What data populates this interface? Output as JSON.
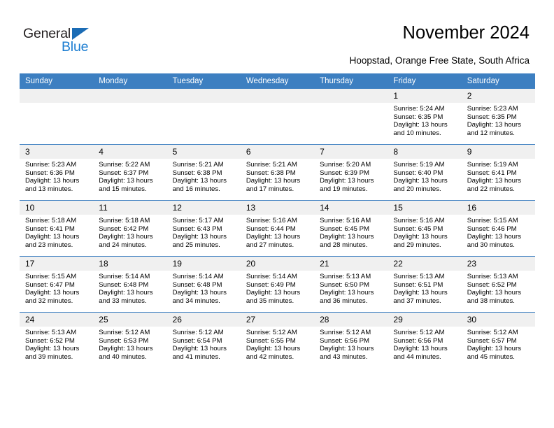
{
  "brand": {
    "name_top": "General",
    "name_bottom": "Blue",
    "color_dark": "#231f20",
    "color_blue": "#1b7dd1"
  },
  "header": {
    "title": "November 2024",
    "subtitle": "Hoopstad, Orange Free State, South Africa"
  },
  "theme": {
    "header_row_bg": "#3d7fc1",
    "daynum_bg": "#f0f0f0",
    "grid_line": "#3d7fc1"
  },
  "weekdays": [
    "Sunday",
    "Monday",
    "Tuesday",
    "Wednesday",
    "Thursday",
    "Friday",
    "Saturday"
  ],
  "weeks": [
    [
      {
        "day": "",
        "empty": true
      },
      {
        "day": "",
        "empty": true
      },
      {
        "day": "",
        "empty": true
      },
      {
        "day": "",
        "empty": true
      },
      {
        "day": "",
        "empty": true
      },
      {
        "day": "1",
        "sunrise": "Sunrise: 5:24 AM",
        "sunset": "Sunset: 6:35 PM",
        "daylight": "Daylight: 13 hours and 10 minutes."
      },
      {
        "day": "2",
        "sunrise": "Sunrise: 5:23 AM",
        "sunset": "Sunset: 6:35 PM",
        "daylight": "Daylight: 13 hours and 12 minutes."
      }
    ],
    [
      {
        "day": "3",
        "sunrise": "Sunrise: 5:23 AM",
        "sunset": "Sunset: 6:36 PM",
        "daylight": "Daylight: 13 hours and 13 minutes."
      },
      {
        "day": "4",
        "sunrise": "Sunrise: 5:22 AM",
        "sunset": "Sunset: 6:37 PM",
        "daylight": "Daylight: 13 hours and 15 minutes."
      },
      {
        "day": "5",
        "sunrise": "Sunrise: 5:21 AM",
        "sunset": "Sunset: 6:38 PM",
        "daylight": "Daylight: 13 hours and 16 minutes."
      },
      {
        "day": "6",
        "sunrise": "Sunrise: 5:21 AM",
        "sunset": "Sunset: 6:38 PM",
        "daylight": "Daylight: 13 hours and 17 minutes."
      },
      {
        "day": "7",
        "sunrise": "Sunrise: 5:20 AM",
        "sunset": "Sunset: 6:39 PM",
        "daylight": "Daylight: 13 hours and 19 minutes."
      },
      {
        "day": "8",
        "sunrise": "Sunrise: 5:19 AM",
        "sunset": "Sunset: 6:40 PM",
        "daylight": "Daylight: 13 hours and 20 minutes."
      },
      {
        "day": "9",
        "sunrise": "Sunrise: 5:19 AM",
        "sunset": "Sunset: 6:41 PM",
        "daylight": "Daylight: 13 hours and 22 minutes."
      }
    ],
    [
      {
        "day": "10",
        "sunrise": "Sunrise: 5:18 AM",
        "sunset": "Sunset: 6:41 PM",
        "daylight": "Daylight: 13 hours and 23 minutes."
      },
      {
        "day": "11",
        "sunrise": "Sunrise: 5:18 AM",
        "sunset": "Sunset: 6:42 PM",
        "daylight": "Daylight: 13 hours and 24 minutes."
      },
      {
        "day": "12",
        "sunrise": "Sunrise: 5:17 AM",
        "sunset": "Sunset: 6:43 PM",
        "daylight": "Daylight: 13 hours and 25 minutes."
      },
      {
        "day": "13",
        "sunrise": "Sunrise: 5:16 AM",
        "sunset": "Sunset: 6:44 PM",
        "daylight": "Daylight: 13 hours and 27 minutes."
      },
      {
        "day": "14",
        "sunrise": "Sunrise: 5:16 AM",
        "sunset": "Sunset: 6:45 PM",
        "daylight": "Daylight: 13 hours and 28 minutes."
      },
      {
        "day": "15",
        "sunrise": "Sunrise: 5:16 AM",
        "sunset": "Sunset: 6:45 PM",
        "daylight": "Daylight: 13 hours and 29 minutes."
      },
      {
        "day": "16",
        "sunrise": "Sunrise: 5:15 AM",
        "sunset": "Sunset: 6:46 PM",
        "daylight": "Daylight: 13 hours and 30 minutes."
      }
    ],
    [
      {
        "day": "17",
        "sunrise": "Sunrise: 5:15 AM",
        "sunset": "Sunset: 6:47 PM",
        "daylight": "Daylight: 13 hours and 32 minutes."
      },
      {
        "day": "18",
        "sunrise": "Sunrise: 5:14 AM",
        "sunset": "Sunset: 6:48 PM",
        "daylight": "Daylight: 13 hours and 33 minutes."
      },
      {
        "day": "19",
        "sunrise": "Sunrise: 5:14 AM",
        "sunset": "Sunset: 6:48 PM",
        "daylight": "Daylight: 13 hours and 34 minutes."
      },
      {
        "day": "20",
        "sunrise": "Sunrise: 5:14 AM",
        "sunset": "Sunset: 6:49 PM",
        "daylight": "Daylight: 13 hours and 35 minutes."
      },
      {
        "day": "21",
        "sunrise": "Sunrise: 5:13 AM",
        "sunset": "Sunset: 6:50 PM",
        "daylight": "Daylight: 13 hours and 36 minutes."
      },
      {
        "day": "22",
        "sunrise": "Sunrise: 5:13 AM",
        "sunset": "Sunset: 6:51 PM",
        "daylight": "Daylight: 13 hours and 37 minutes."
      },
      {
        "day": "23",
        "sunrise": "Sunrise: 5:13 AM",
        "sunset": "Sunset: 6:52 PM",
        "daylight": "Daylight: 13 hours and 38 minutes."
      }
    ],
    [
      {
        "day": "24",
        "sunrise": "Sunrise: 5:13 AM",
        "sunset": "Sunset: 6:52 PM",
        "daylight": "Daylight: 13 hours and 39 minutes."
      },
      {
        "day": "25",
        "sunrise": "Sunrise: 5:12 AM",
        "sunset": "Sunset: 6:53 PM",
        "daylight": "Daylight: 13 hours and 40 minutes."
      },
      {
        "day": "26",
        "sunrise": "Sunrise: 5:12 AM",
        "sunset": "Sunset: 6:54 PM",
        "daylight": "Daylight: 13 hours and 41 minutes."
      },
      {
        "day": "27",
        "sunrise": "Sunrise: 5:12 AM",
        "sunset": "Sunset: 6:55 PM",
        "daylight": "Daylight: 13 hours and 42 minutes."
      },
      {
        "day": "28",
        "sunrise": "Sunrise: 5:12 AM",
        "sunset": "Sunset: 6:56 PM",
        "daylight": "Daylight: 13 hours and 43 minutes."
      },
      {
        "day": "29",
        "sunrise": "Sunrise: 5:12 AM",
        "sunset": "Sunset: 6:56 PM",
        "daylight": "Daylight: 13 hours and 44 minutes."
      },
      {
        "day": "30",
        "sunrise": "Sunrise: 5:12 AM",
        "sunset": "Sunset: 6:57 PM",
        "daylight": "Daylight: 13 hours and 45 minutes."
      }
    ]
  ]
}
